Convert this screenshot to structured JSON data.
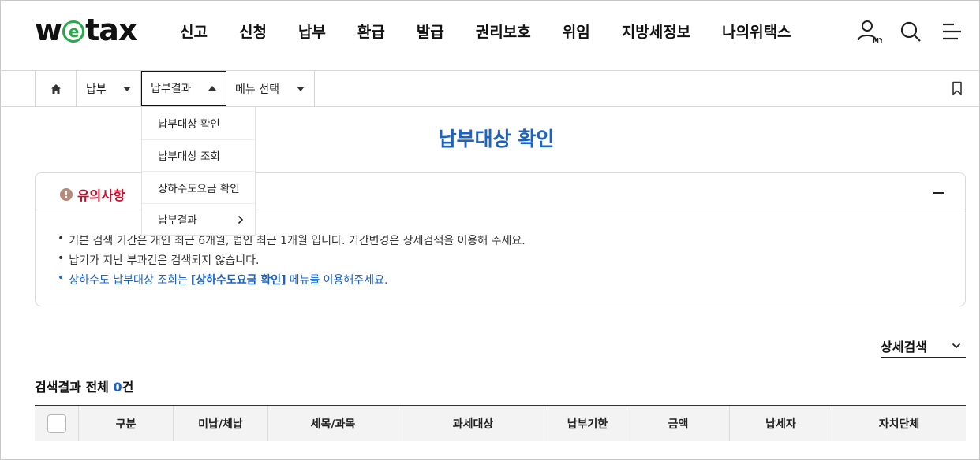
{
  "header": {
    "logo_pre": "w",
    "logo_e": "e",
    "logo_post": "tax",
    "menu": [
      "신고",
      "신청",
      "납부",
      "환급",
      "발급",
      "권리보호",
      "위임",
      "지방세정보",
      "나의위택스"
    ],
    "icons": [
      "user-my-icon",
      "search-icon",
      "menu-icon"
    ],
    "my_label": "MY"
  },
  "breadcrumb": {
    "level1": "납부",
    "level2": "납부결과",
    "level3": "메뉴 선택"
  },
  "dropdown": {
    "items": [
      "납부대상 확인",
      "납부대상 조회",
      "상하수도요금 확인",
      "납부결과"
    ]
  },
  "page": {
    "title": "납부대상 확인"
  },
  "notice": {
    "title": "유의사항",
    "line1": "기본 검색 기간은 개인 최근 6개월, 법인 최근 1개월 입니다. 기간변경은 상세검색을 이용해 주세요.",
    "line2": "납기가 지난 부과건은 검색되지 않습니다.",
    "line3_pre": "상하수도 납부대상 조회는",
    "line3_link": "[상하수도요금 확인]",
    "line3_post": "메뉴를 이용해주세요."
  },
  "search": {
    "detail_label": "상세검색"
  },
  "results": {
    "label_pre": "검색결과 전체",
    "count": "0",
    "label_post": "건"
  },
  "table": {
    "headers": [
      "구분",
      "미납/체납",
      "세목/과목",
      "과세대상",
      "납부기한",
      "금액",
      "납세자",
      "자치단체"
    ]
  },
  "colors": {
    "accent": "#1a63c4",
    "warning": "#c8102e",
    "logo_green": "#2aa84a"
  }
}
